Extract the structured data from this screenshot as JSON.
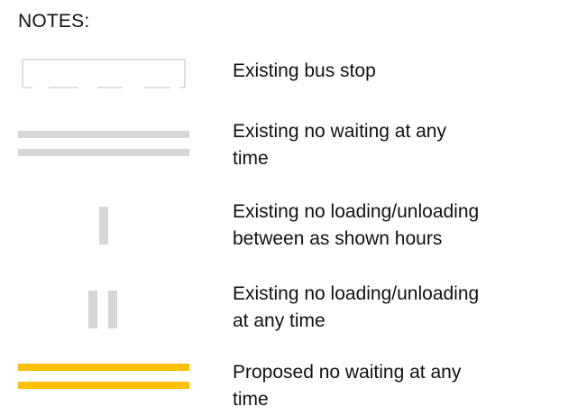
{
  "legend": {
    "title": "NOTES:",
    "colors": {
      "existing": "#d6d6d6",
      "proposed": "#ffc000"
    },
    "items": [
      {
        "label": "Existing bus stop",
        "symbol": "bus-stop-box"
      },
      {
        "label": "Existing no waiting at any\ntime",
        "symbol": "double-line-grey"
      },
      {
        "label": "Existing no loading/unloading\nbetween as shown hours",
        "symbol": "single-kerb-mark-grey"
      },
      {
        "label": "Existing no loading/unloading\nat any time",
        "symbol": "double-kerb-mark-grey"
      },
      {
        "label": "Proposed no waiting at any\ntime",
        "symbol": "double-line-yellow"
      }
    ]
  }
}
